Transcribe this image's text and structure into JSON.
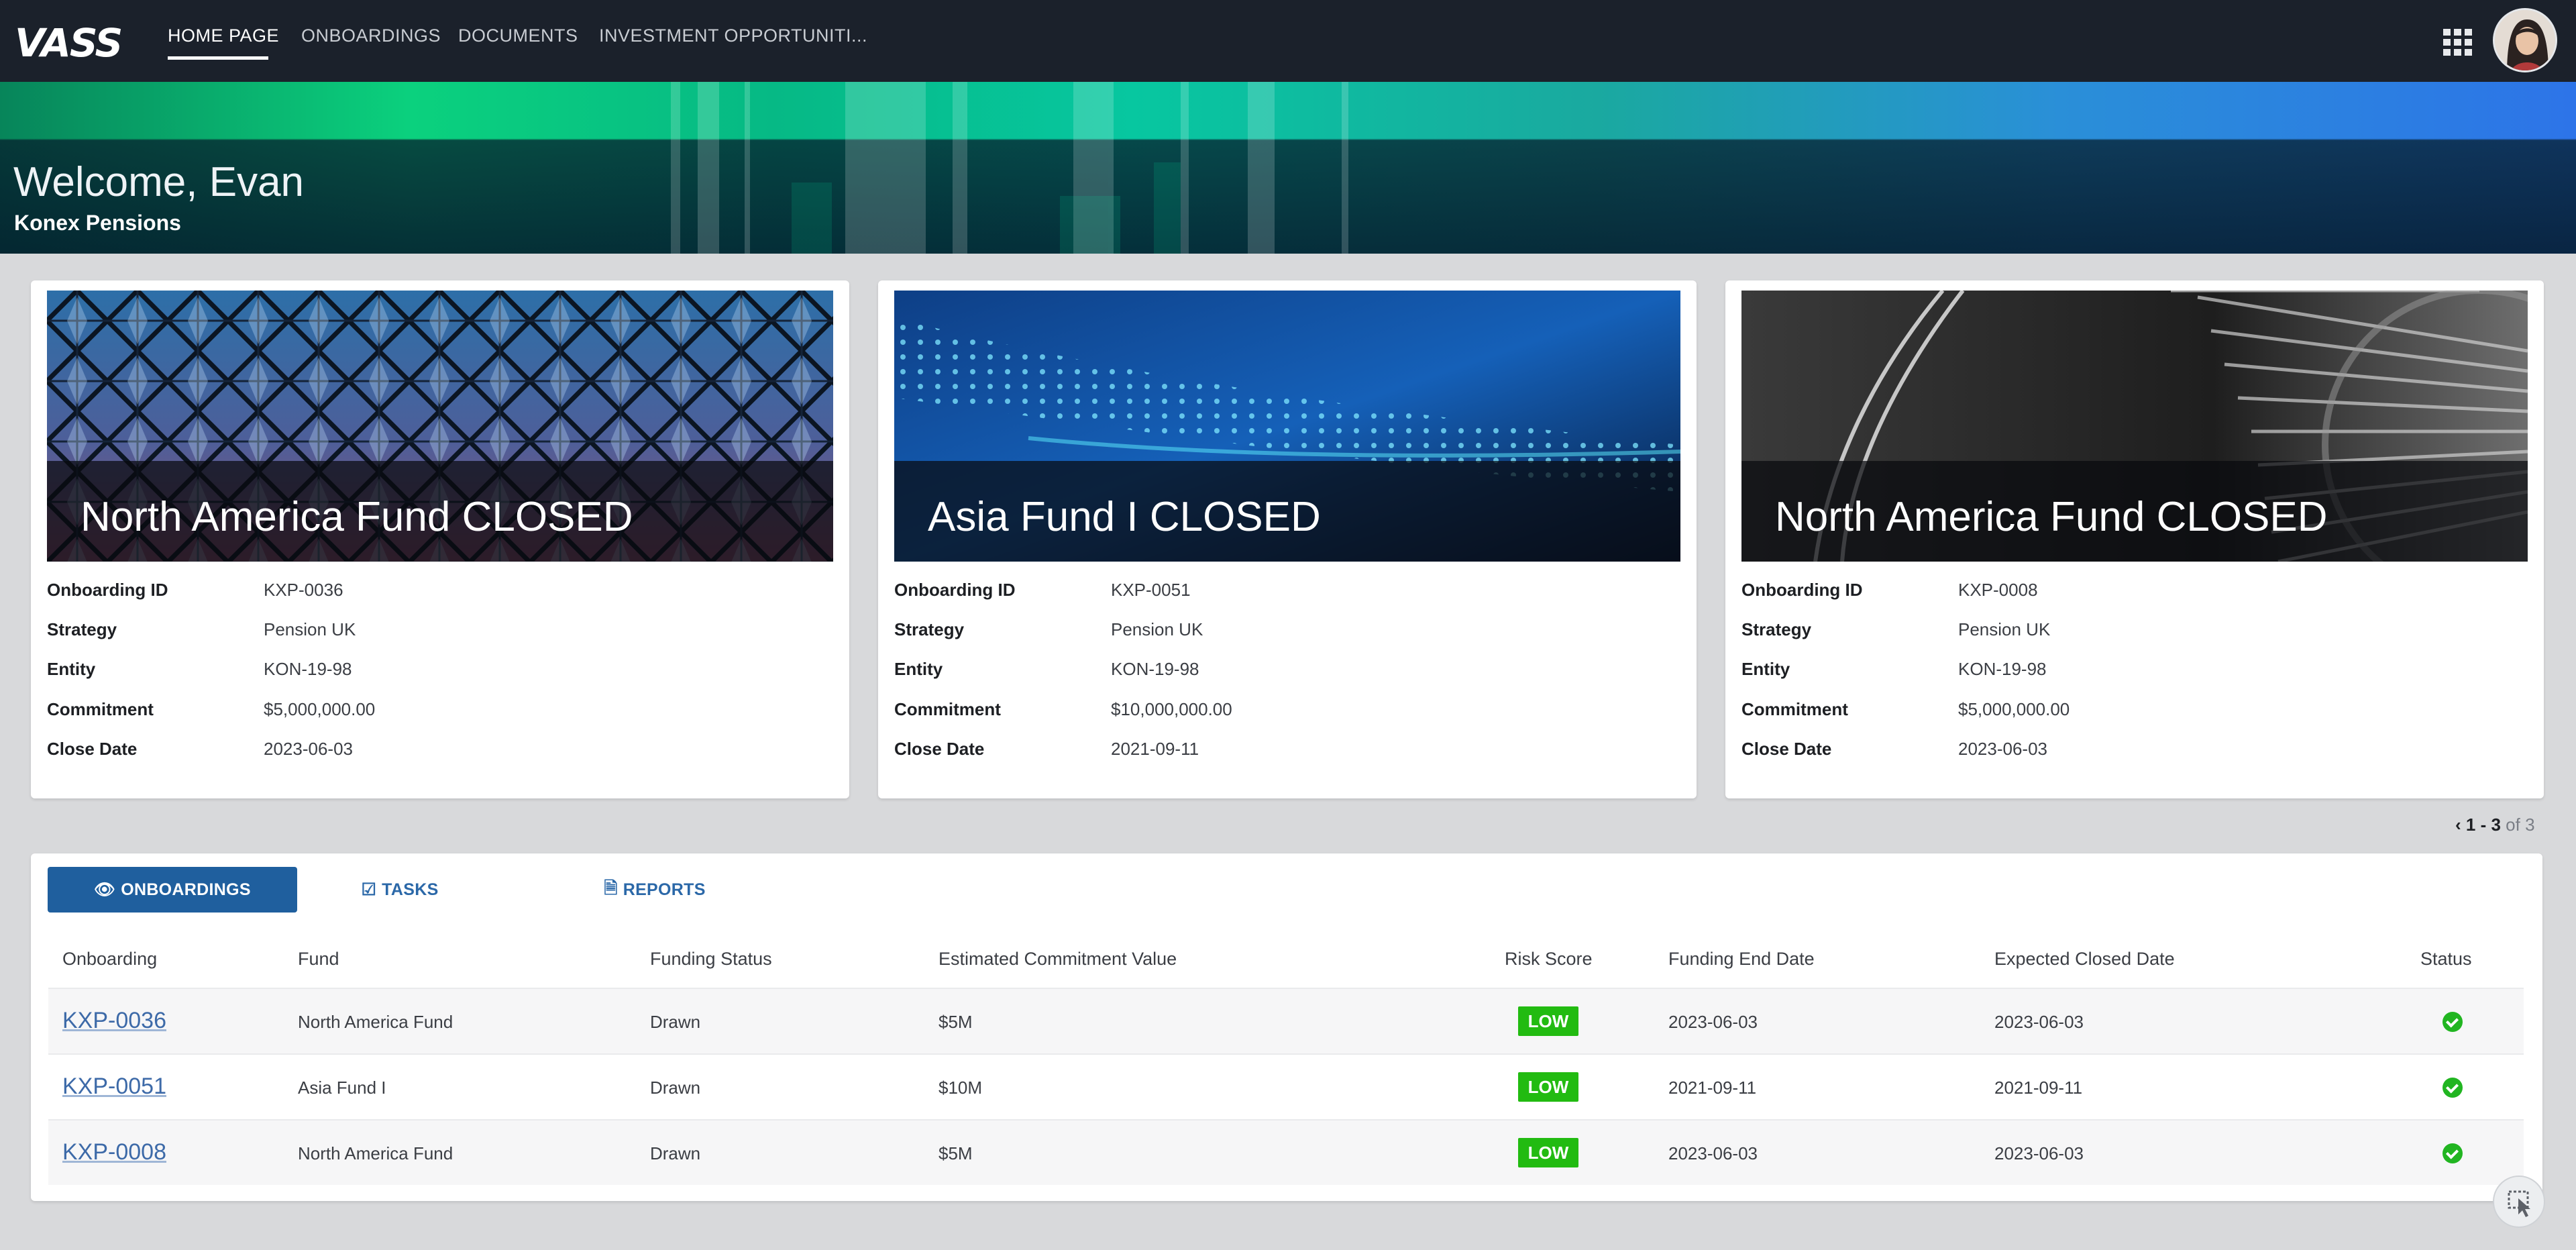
{
  "nav": {
    "logo": "VASS",
    "items": [
      {
        "label": "HOME PAGE",
        "active": true
      },
      {
        "label": "ONBOARDINGS",
        "active": false
      },
      {
        "label": "DOCUMENTS",
        "active": false
      },
      {
        "label": "INVESTMENT OPPORTUNITI...",
        "active": false
      }
    ],
    "apps_icon": "apps-grid-icon"
  },
  "hero": {
    "welcome": "Welcome, Evan",
    "company": "Konex Pensions"
  },
  "cards": [
    {
      "title": "North America Fund  CLOSED",
      "labels": [
        "Onboarding ID",
        "Strategy",
        "Entity",
        "Commitment",
        "Close Date"
      ],
      "values": [
        "KXP-0036",
        "Pension UK",
        "KON-19-98",
        "$5,000,000.00",
        "2023-06-03"
      ]
    },
    {
      "title": "Asia Fund I  CLOSED",
      "labels": [
        "Onboarding ID",
        "Strategy",
        "Entity",
        "Commitment",
        "Close Date"
      ],
      "values": [
        "KXP-0051",
        "Pension UK",
        "KON-19-98",
        "$10,000,000.00",
        "2021-09-11"
      ]
    },
    {
      "title": "North America Fund  CLOSED",
      "labels": [
        "Onboarding ID",
        "Strategy",
        "Entity",
        "Commitment",
        "Close Date"
      ],
      "values": [
        "KXP-0008",
        "Pension UK",
        "KON-19-98",
        "$5,000,000.00",
        "2023-06-03"
      ]
    }
  ],
  "pager": {
    "range": "1 - 3",
    "of": "of 3",
    "prev_icon": "chevron-left-icon"
  },
  "tabs": [
    {
      "label": "ONBOARDINGS",
      "icon": "eye-icon",
      "glyph": "👁",
      "active": true
    },
    {
      "label": "TASKS",
      "icon": "checkbox-icon",
      "glyph": "☑",
      "active": false
    },
    {
      "label": "REPORTS",
      "icon": "document-icon",
      "glyph": "🗎",
      "active": false
    }
  ],
  "table": {
    "headers": [
      "Onboarding",
      "Fund",
      "Funding Status",
      "Estimated Commitment Value",
      "Risk Score",
      "Funding End Date",
      "Expected Closed Date",
      "Status"
    ],
    "rows": [
      [
        "KXP-0036",
        "North America Fund",
        "Drawn",
        "$5M",
        "LOW",
        "2023-06-03",
        "2023-06-03"
      ],
      [
        "KXP-0051",
        "Asia Fund I",
        "Drawn",
        "$10M",
        "LOW",
        "2021-09-11",
        "2021-09-11"
      ],
      [
        "KXP-0008",
        "North America Fund",
        "Drawn",
        "$5M",
        "LOW",
        "2023-06-03",
        "2023-06-03"
      ]
    ],
    "status_icon": "check-circle-icon"
  },
  "colors": {
    "nav_bg": "#1b212b",
    "primary": "#1f5f9e",
    "link": "#3d6aa8",
    "low_badge": "#22bb11",
    "status_ok": "#21b521"
  }
}
